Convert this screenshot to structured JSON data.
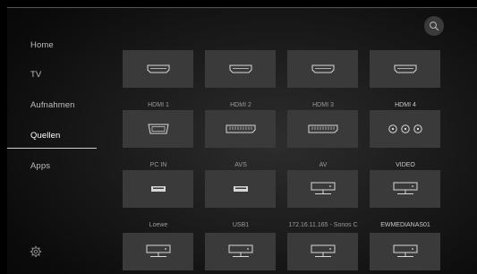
{
  "nav": {
    "items": [
      {
        "label": "Home"
      },
      {
        "label": "TV"
      },
      {
        "label": "Aufnahmen"
      },
      {
        "label": "Quellen"
      },
      {
        "label": "Apps"
      }
    ],
    "active": "Quellen"
  },
  "sources": [
    {
      "label": "HDMI 1",
      "icon": "hdmi-port-icon"
    },
    {
      "label": "HDMI 2",
      "icon": "hdmi-port-icon"
    },
    {
      "label": "HDMI 3",
      "icon": "hdmi-port-icon"
    },
    {
      "label": "HDMI 4",
      "icon": "hdmi-port-icon"
    },
    {
      "label": "PC IN",
      "icon": "vga-port-icon"
    },
    {
      "label": "AVS",
      "icon": "scart-port-icon"
    },
    {
      "label": "AV",
      "icon": "scart-port-icon"
    },
    {
      "label": "VIDEO",
      "icon": "rca-ports-icon"
    },
    {
      "label": "Loewe",
      "icon": "usb-port-icon"
    },
    {
      "label": "USB1",
      "icon": "usb-port-icon"
    },
    {
      "label": "172.16.11.165 - Sonos C",
      "icon": "network-server-icon"
    },
    {
      "label": "EWMEDIANAS01",
      "icon": "network-server-icon"
    },
    {
      "label": "",
      "icon": "network-server-icon"
    },
    {
      "label": "",
      "icon": "network-server-icon"
    },
    {
      "label": "",
      "icon": "network-server-icon"
    },
    {
      "label": "",
      "icon": "network-server-icon"
    }
  ],
  "icons": {
    "settings": "gear-icon",
    "search": "search-icon"
  },
  "colors": {
    "tile": "#3a3a3a",
    "text_active": "#ffffff",
    "text_inactive": "#bdbdbd"
  }
}
